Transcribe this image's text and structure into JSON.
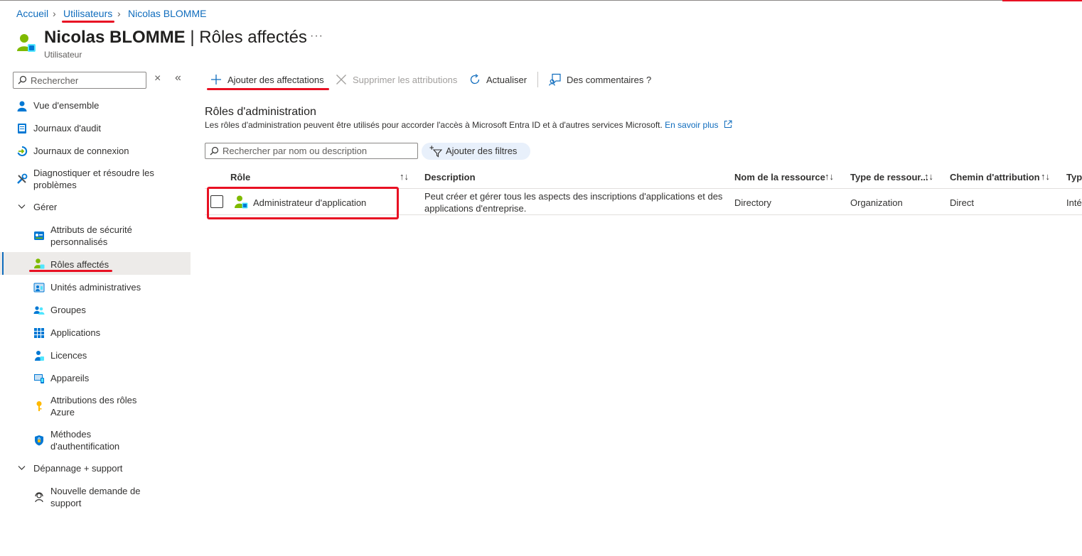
{
  "breadcrumb": {
    "items": [
      {
        "label": "Accueil"
      },
      {
        "label": "Utilisateurs"
      },
      {
        "label": "Nicolas BLOMME"
      }
    ]
  },
  "header": {
    "user_name": "Nicolas BLOMME",
    "separator": "|",
    "page_title": "Rôles affectés",
    "subtitle": "Utilisateur",
    "more_label": "···"
  },
  "sidebar": {
    "search_placeholder": "Rechercher",
    "clear_label": "×",
    "collapse_label": "«",
    "items": [
      {
        "label": "Vue d'ensemble",
        "icon": "user-icon"
      },
      {
        "label": "Journaux d'audit",
        "icon": "audit-log-icon"
      },
      {
        "label": "Journaux de connexion",
        "icon": "sign-in-log-icon"
      },
      {
        "label": "Diagnostiquer et résoudre les problèmes",
        "icon": "wrench-icon"
      }
    ],
    "group_manage": {
      "label": "Gérer",
      "items": [
        {
          "label": "Attributs de sécurité personnalisés",
          "icon": "security-attributes-icon"
        },
        {
          "label": "Rôles affectés",
          "icon": "assigned-roles-icon",
          "selected": true
        },
        {
          "label": "Unités administratives",
          "icon": "admin-units-icon"
        },
        {
          "label": "Groupes",
          "icon": "groups-icon"
        },
        {
          "label": "Applications",
          "icon": "applications-grid-icon"
        },
        {
          "label": "Licences",
          "icon": "licenses-icon"
        },
        {
          "label": "Appareils",
          "icon": "devices-icon"
        },
        {
          "label": "Attributions des rôles Azure",
          "icon": "key-icon"
        },
        {
          "label": "Méthodes d'authentification",
          "icon": "shield-icon"
        }
      ]
    },
    "group_support": {
      "label": "Dépannage + support",
      "items": [
        {
          "label": "Nouvelle demande de support",
          "icon": "support-icon"
        }
      ]
    }
  },
  "toolbar": {
    "add_label": "Ajouter des affectations",
    "remove_label": "Supprimer les attributions",
    "refresh_label": "Actualiser",
    "feedback_label": "Des commentaires ?"
  },
  "section": {
    "title": "Rôles d'administration",
    "description": "Les rôles d'administration peuvent être utilisés pour accorder l'accès à Microsoft Entra ID et à d'autres services Microsoft.",
    "learn_more": "En savoir plus"
  },
  "table_controls": {
    "search_placeholder": "Rechercher par nom ou description",
    "filter_label": "Ajouter des filtres"
  },
  "table": {
    "columns": [
      {
        "label": "Rôle",
        "sort": "↑↓"
      },
      {
        "label": "Description"
      },
      {
        "label": "Nom de la ressource",
        "sort": "↑↓"
      },
      {
        "label": "Type de ressour...",
        "sort": "↑↓"
      },
      {
        "label": "Chemin d'attribution",
        "sort": "↑↓"
      },
      {
        "label": "Typ"
      }
    ],
    "rows": [
      {
        "role": "Administrateur d'application",
        "description_line1": "Peut créer et gérer tous les aspects des inscriptions d'applications et des",
        "description_line2": "applications d'entreprise.",
        "resource_name": "Directory",
        "resource_type": "Organization",
        "assignment_path": "Direct",
        "type": "Inté"
      }
    ]
  },
  "colors": {
    "accent": "#0f6cbd",
    "annotation_red": "#e81123",
    "selected_bg": "#edebe9"
  }
}
